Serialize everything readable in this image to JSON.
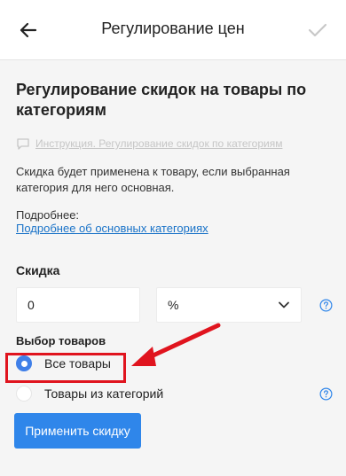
{
  "header": {
    "title": "Регулирование цен"
  },
  "main": {
    "heading": "Регулирование скидок на товары по категориям",
    "instruction_link": "Инструкция. Регулирование скидок по категориям",
    "description": "Скидка будет применена к товару, если выбранная категория для него основная.",
    "more_label": "Подробнее:",
    "more_link": "Подробнее об основных категориях",
    "discount_label": "Скидка",
    "discount_value": "0",
    "discount_unit": "%",
    "products_label": "Выбор товаров",
    "options": [
      {
        "label": "Все товары",
        "selected": true
      },
      {
        "label": "Товары из категорий",
        "selected": false
      }
    ],
    "apply_button": "Применить скидку"
  },
  "colors": {
    "accent": "#2f86ea",
    "link": "#1a73c8",
    "highlight": "#e0141e"
  },
  "icons": {
    "back": "arrow-left-icon",
    "confirm": "check-icon",
    "chat": "chat-bubble-icon",
    "dropdown": "chevron-down-icon",
    "help": "question-circle-icon"
  }
}
